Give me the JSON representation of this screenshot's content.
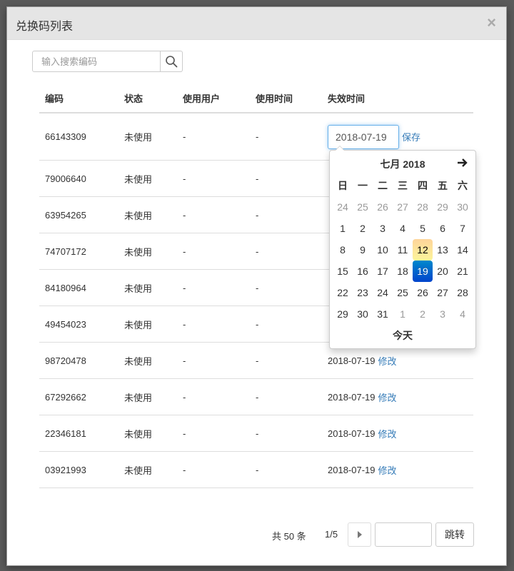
{
  "modal": {
    "title": "兑换码列表",
    "close_glyph": "×"
  },
  "search": {
    "placeholder": "输入搜索编码",
    "icon": "search-icon"
  },
  "table": {
    "headers": [
      "编码",
      "状态",
      "使用用户",
      "使用时间",
      "失效时间"
    ],
    "editing_row": {
      "code": "66143309",
      "status": "未使用",
      "user": "-",
      "time": "-",
      "date_value": "2018-07-19",
      "save_label": "保存"
    },
    "rows": [
      {
        "code": "79006640",
        "status": "未使用",
        "user": "-",
        "time": "-"
      },
      {
        "code": "63954265",
        "status": "未使用",
        "user": "-",
        "time": "-"
      },
      {
        "code": "74707172",
        "status": "未使用",
        "user": "-",
        "time": "-"
      },
      {
        "code": "84180964",
        "status": "未使用",
        "user": "-",
        "time": "-"
      },
      {
        "code": "49454023",
        "status": "未使用",
        "user": "-",
        "time": "-"
      },
      {
        "code": "98720478",
        "status": "未使用",
        "user": "-",
        "time": "-",
        "expiry": "2018-07-19",
        "edit_label": "修改"
      },
      {
        "code": "67292662",
        "status": "未使用",
        "user": "-",
        "time": "-",
        "expiry": "2018-07-19",
        "edit_label": "修改"
      },
      {
        "code": "22346181",
        "status": "未使用",
        "user": "-",
        "time": "-",
        "expiry": "2018-07-19",
        "edit_label": "修改"
      },
      {
        "code": "03921993",
        "status": "未使用",
        "user": "-",
        "time": "-",
        "expiry": "2018-07-19",
        "edit_label": "修改"
      }
    ]
  },
  "datepicker": {
    "month_label": "七月 2018",
    "next_glyph": "🡒",
    "weekdays": [
      "日",
      "一",
      "二",
      "三",
      "四",
      "五",
      "六"
    ],
    "weeks": [
      [
        "24",
        "25",
        "26",
        "27",
        "28",
        "29",
        "30"
      ],
      [
        "1",
        "2",
        "3",
        "4",
        "5",
        "6",
        "7"
      ],
      [
        "8",
        "9",
        "10",
        "11",
        "12",
        "13",
        "14"
      ],
      [
        "15",
        "16",
        "17",
        "18",
        "19",
        "20",
        "21"
      ],
      [
        "22",
        "23",
        "24",
        "25",
        "26",
        "27",
        "28"
      ],
      [
        "29",
        "30",
        "31",
        "1",
        "2",
        "3",
        "4"
      ]
    ],
    "today_day": "12",
    "selected_day": "19",
    "today_label": "今天",
    "colors": {
      "today_bg": "#fde19a",
      "selected_bg": "#0066cc"
    }
  },
  "pagination": {
    "total": "共 50 条",
    "page_info": "1/5",
    "jump_label": "跳转"
  },
  "colors": {
    "link": "#337ab7",
    "header_bg": "#e5e5e5"
  }
}
